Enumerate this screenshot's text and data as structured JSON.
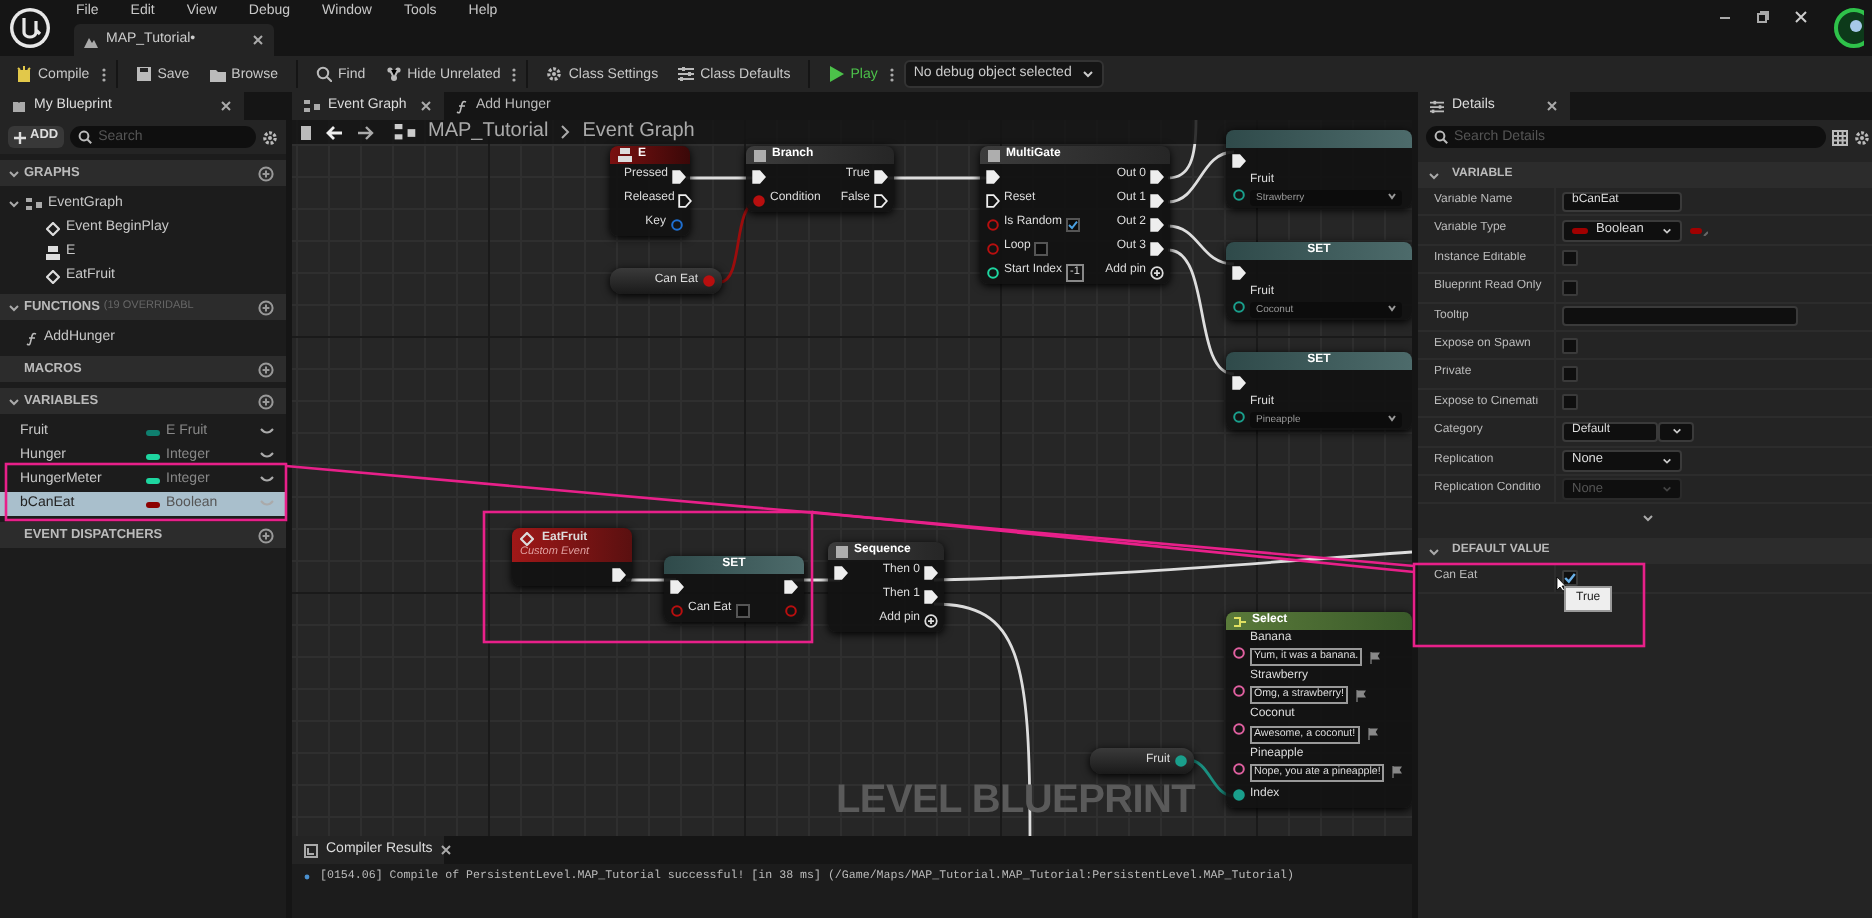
{
  "menu": [
    "File",
    "Edit",
    "View",
    "Debug",
    "Window",
    "Tools",
    "Help"
  ],
  "document_tab": {
    "label": "MAP_Tutorial•"
  },
  "toolbar": {
    "buttons": [
      {
        "kind": "compile",
        "label": "Compile",
        "has_menu": true
      },
      {
        "kind": "save",
        "label": "Save",
        "has_menu": false
      },
      {
        "kind": "browse",
        "label": "Browse",
        "has_menu": false
      },
      {
        "kind": "find",
        "label": "Find",
        "has_menu": false
      },
      {
        "kind": "hide_unrelated",
        "label": "Hide Unrelated",
        "has_menu": true
      },
      {
        "kind": "class_settings",
        "label": "Class Settings",
        "has_menu": false
      },
      {
        "kind": "class_defaults",
        "label": "Class Defaults",
        "has_menu": false
      },
      {
        "kind": "play",
        "label": "Play",
        "has_menu": true
      }
    ],
    "debug_object": "No debug object selected"
  },
  "my_blueprint": {
    "tab": "My Blueprint",
    "add_label": "ADD",
    "search_placeholder": "Search",
    "sections": [
      {
        "kind": "tree",
        "title": "GRAPHS",
        "expanded": true,
        "items": [
          {
            "kind": "graph",
            "label": "EventGraph",
            "expanded": true,
            "selected": false,
            "children": [
              {
                "kind": "event",
                "label": "Event BeginPlay",
                "selected": false
              },
              {
                "kind": "input",
                "label": "E",
                "selected": false
              },
              {
                "kind": "event",
                "label": "EatFruit",
                "selected": false
              }
            ]
          }
        ]
      },
      {
        "kind": "tree",
        "title": "FUNCTIONS",
        "note": "(19 OVERRIDABL",
        "expanded": true,
        "items": [
          {
            "kind": "function",
            "label": "AddHunger",
            "selected": false
          }
        ]
      },
      {
        "title": "MACROS"
      },
      {
        "kind": "variables",
        "title": "VARIABLES",
        "expanded": true,
        "items": [
          {
            "name": "Fruit",
            "type": "E Fruit",
            "color": "#0f7f6f",
            "selected": false
          },
          {
            "name": "Hunger",
            "type": "Integer",
            "color": "#1ed6a0",
            "selected": false
          },
          {
            "name": "HungerMeter",
            "type": "Integer",
            "color": "#1ed6a0",
            "selected": false
          },
          {
            "name": "bCanEat",
            "type": "Boolean",
            "color": "#8c0000",
            "selected": true
          }
        ]
      },
      {
        "title": "EVENT DISPATCHERS"
      }
    ]
  },
  "graph": {
    "tabs": [
      {
        "kind": "graph",
        "label": "Event Graph",
        "selected": true
      },
      {
        "kind": "function",
        "label": "Add Hunger",
        "selected": false
      }
    ],
    "breadcrumb": [
      "MAP_Tutorial",
      "Event Graph"
    ],
    "nodes": [
      {
        "kind": "input_event",
        "title": "E",
        "rows": [
          {
            "right": {
              "kind": "exec",
              "label": "Pressed",
              "connected": true
            }
          },
          {
            "right": {
              "kind": "exec",
              "label": "Released",
              "connected": false
            }
          },
          {
            "right": {
              "kind": "struct",
              "label": "Key",
              "connected": false
            }
          }
        ]
      },
      {
        "kind": "getter",
        "rows": [
          {
            "right": {
              "kind": "bool",
              "label": "Can Eat",
              "connected": true
            }
          }
        ]
      },
      {
        "kind": "function",
        "title": "Branch",
        "rows": [
          {
            "left": {
              "kind": "exec",
              "connected": true
            },
            "right": {
              "kind": "exec",
              "label": "True",
              "connected": true
            }
          },
          {
            "left": {
              "kind": "bool",
              "label": "Condition",
              "connected": true
            },
            "right": {
              "kind": "exec",
              "label": "False",
              "connected": false
            }
          }
        ]
      },
      {
        "kind": "function",
        "title": "MultiGate",
        "rows": [
          {
            "left": {
              "kind": "exec",
              "connected": true
            },
            "right": {
              "kind": "exec",
              "label": "Out 0",
              "connected": true
            }
          },
          {
            "left": {
              "kind": "exec",
              "label": "Reset",
              "connected": false
            },
            "right": {
              "kind": "exec",
              "label": "Out 1",
              "connected": true
            }
          },
          {
            "left": {
              "kind": "bool",
              "label": "Is Random",
              "connected": false,
              "checked": true
            },
            "right": {
              "kind": "exec",
              "label": "Out 2",
              "connected": true
            }
          },
          {
            "left": {
              "kind": "bool",
              "label": "Loop",
              "connected": false,
              "checked": false
            },
            "right": {
              "kind": "exec",
              "label": "Out 3",
              "connected": true
            }
          },
          {
            "left": {
              "kind": "int",
              "label": "Start Index",
              "connected": false,
              "value": "-1"
            },
            "right": {
              "kind": "add_pin",
              "label": "Add pin"
            }
          }
        ]
      },
      {
        "kind": "set",
        "rows": [
          {
            "left": {
              "kind": "exec",
              "connected": true
            }
          },
          {
            "left": {
              "kind": "enum",
              "label": "Fruit",
              "connected": false,
              "dropdown": "Strawberry"
            }
          }
        ]
      },
      {
        "kind": "set",
        "title": "SET",
        "rows": [
          {
            "left": {
              "kind": "exec",
              "connected": true
            }
          },
          {
            "left": {
              "kind": "enum",
              "label": "Fruit",
              "connected": false,
              "dropdown": "Coconut"
            }
          }
        ]
      },
      {
        "kind": "set",
        "title": "SET",
        "rows": [
          {
            "left": {
              "kind": "exec",
              "connected": true
            }
          },
          {
            "left": {
              "kind": "enum",
              "label": "Fruit",
              "connected": false,
              "dropdown": "Pineapple"
            }
          }
        ]
      },
      {
        "kind": "custom_event",
        "title": "EatFruit",
        "subtitle": "Custom Event",
        "rows": [
          {
            "right": {
              "kind": "exec",
              "connected": true
            }
          }
        ]
      },
      {
        "kind": "set",
        "title": "SET",
        "rows": [
          {
            "left": {
              "kind": "exec",
              "connected": true
            },
            "right": {
              "kind": "exec",
              "connected": true
            }
          },
          {
            "left": {
              "kind": "bool",
              "label": "Can Eat",
              "connected": false,
              "checked": false
            },
            "right": {
              "kind": "bool",
              "connected": false
            }
          }
        ]
      },
      {
        "kind": "function",
        "title": "Sequence",
        "rows": [
          {
            "left": {
              "kind": "exec",
              "connected": true
            },
            "right": {
              "kind": "exec",
              "label": "Then 0",
              "connected": true
            }
          },
          {
            "right": {
              "kind": "exec",
              "label": "Then 1",
              "connected": true
            }
          },
          {
            "right": {
              "kind": "add_pin",
              "label": "Add pin"
            }
          }
        ]
      },
      {
        "kind": "getter",
        "rows": [
          {
            "right": {
              "kind": "enum",
              "label": "Fruit",
              "connected": true
            }
          }
        ]
      },
      {
        "kind": "select",
        "title": "Select",
        "rows": [
          {
            "left": {
              "kind": "string",
              "label": "Banana",
              "connected": false,
              "field": "Yum, it was a banana."
            }
          },
          {
            "left": {
              "kind": "string",
              "label": "Strawberry",
              "connected": false,
              "field": "Omg, a strawberry!"
            }
          },
          {
            "left": {
              "kind": "string",
              "label": "Coconut",
              "connected": false,
              "field": "Awesome, a coconut!"
            }
          },
          {
            "left": {
              "kind": "string",
              "label": "Pineapple",
              "connected": false,
              "field": "Nope, you ate a pineapple!"
            }
          },
          {
            "left": {
              "kind": "enum",
              "label": "Index",
              "connected": true
            }
          }
        ]
      }
    ],
    "watermark": "LEVEL BLUEPRINT"
  },
  "compiler": {
    "tab": "Compiler Results",
    "messages": [
      "[0154.06] Compile of PersistentLevel.MAP_Tutorial successful! [in 38 ms] (/Game/Maps/MAP_Tutorial.MAP_Tutorial:PersistentLevel.MAP_Tutorial)"
    ]
  },
  "details": {
    "tab": "Details",
    "search_placeholder": "Search Details",
    "tooltip": "True",
    "sections": [
      {
        "title": "VARIABLE",
        "expanded": true,
        "rows": [
          {
            "kind": "text",
            "label": "Variable Name",
            "value": "bCanEat"
          },
          {
            "kind": "type",
            "label": "Variable Type",
            "value": "Boolean",
            "color": "#a00000"
          },
          {
            "kind": "check",
            "label": "Instance Editable",
            "checked": false
          },
          {
            "kind": "check",
            "label": "Blueprint Read Only",
            "checked": false
          },
          {
            "kind": "text",
            "label": "Tooltip"
          },
          {
            "kind": "check",
            "label": "Expose on Spawn",
            "checked": false
          },
          {
            "kind": "check",
            "label": "Private",
            "checked": false
          },
          {
            "kind": "check",
            "label": "Expose to Cinemati",
            "checked": false
          },
          {
            "kind": "combo",
            "label": "Category",
            "value": "Default"
          },
          {
            "kind": "select",
            "label": "Replication",
            "value": "None",
            "disabled": false
          },
          {
            "kind": "select",
            "label": "Replication Conditio",
            "value": "None",
            "disabled": true
          }
        ]
      },
      {
        "title": "DEFAULT VALUE",
        "expanded": true,
        "rows": [
          {
            "kind": "check",
            "label": "Can Eat",
            "checked": true,
            "tooltip": true
          }
        ]
      }
    ]
  }
}
